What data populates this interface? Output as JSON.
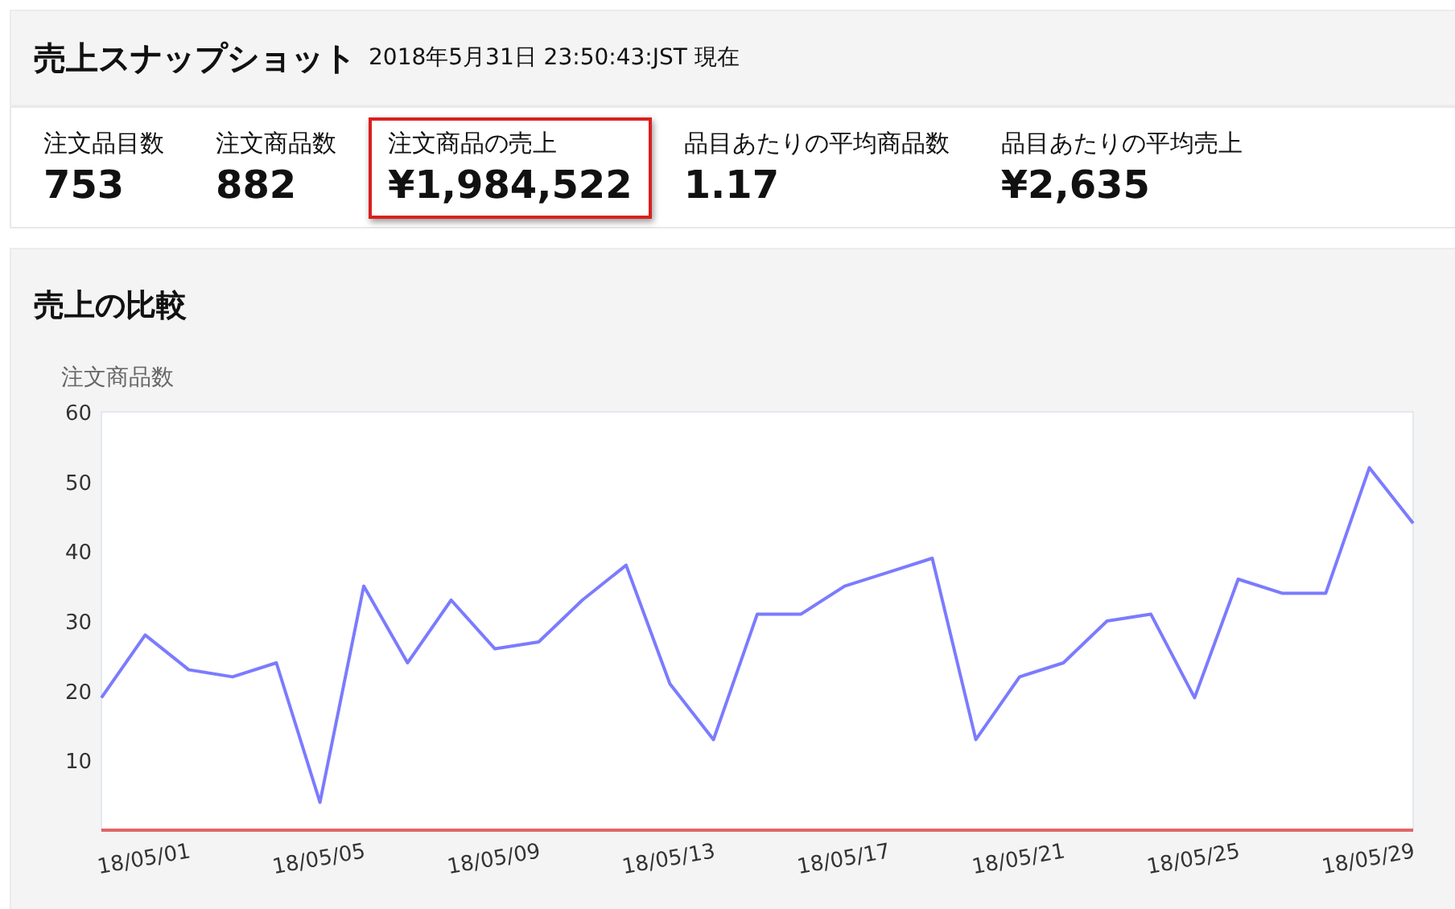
{
  "snapshot": {
    "title": "売上スナップショット",
    "timestamp": "2018年5月31日 23:50:43:JST 現在"
  },
  "metrics": [
    {
      "label": "注文品目数",
      "value": "753",
      "highlighted": false
    },
    {
      "label": "注文商品数",
      "value": "882",
      "highlighted": false
    },
    {
      "label": "注文商品の売上",
      "value": "¥1,984,522",
      "highlighted": true
    },
    {
      "label": "品目あたりの平均商品数",
      "value": "1.17",
      "highlighted": false
    },
    {
      "label": "品目あたりの平均売上",
      "value": "¥2,635",
      "highlighted": false
    }
  ],
  "comparison": {
    "title": "売上の比較",
    "chart_data": {
      "type": "line",
      "ylabel": "注文商品数",
      "categories": [
        null,
        "18/05/01",
        null,
        null,
        null,
        "18/05/05",
        null,
        null,
        null,
        "18/05/09",
        null,
        null,
        null,
        "18/05/13",
        null,
        null,
        null,
        "18/05/17",
        null,
        null,
        null,
        "18/05/21",
        null,
        null,
        null,
        "18/05/25",
        null,
        null,
        null,
        "18/05/29",
        null
      ],
      "series": [
        {
          "color": "#7b7bff",
          "values": [
            19,
            28,
            23,
            22,
            24,
            4,
            35,
            24,
            33,
            26,
            27,
            33,
            38,
            21,
            13,
            31,
            31,
            35,
            37,
            39,
            13,
            22,
            24,
            30,
            31,
            19,
            36,
            34,
            34,
            52,
            44
          ]
        },
        {
          "color": "#e06666",
          "values": [
            0,
            0,
            0,
            0,
            0,
            0,
            0,
            0,
            0,
            0,
            0,
            0,
            0,
            0,
            0,
            0,
            0,
            0,
            0,
            0,
            0,
            0,
            0,
            0,
            0,
            0,
            0,
            0,
            0,
            0,
            0
          ]
        }
      ],
      "ylim": [
        0,
        60
      ],
      "yticks": [
        10,
        20,
        30,
        40,
        50,
        60
      ]
    }
  }
}
